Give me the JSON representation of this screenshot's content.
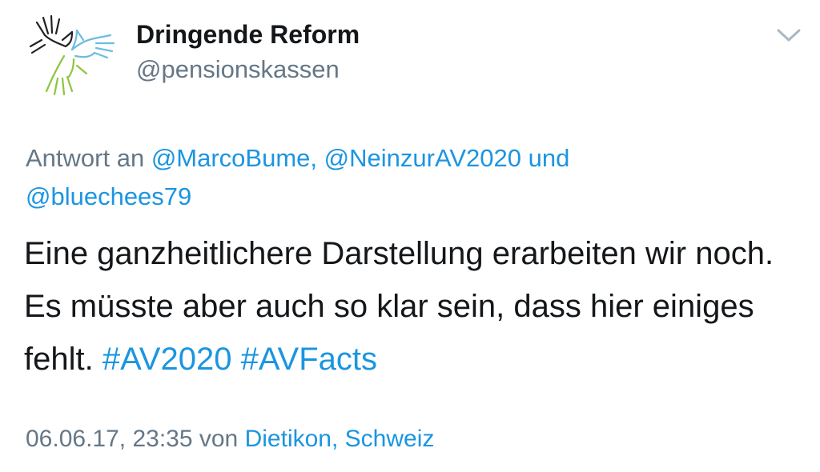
{
  "author": {
    "display_name": "Dringende Reform",
    "handle": "@pensionskassen",
    "avatar_icon": "hands-logo-icon"
  },
  "menu_icon": "chevron-down-icon",
  "reply": {
    "prefix": "Antwort an",
    "mentions": [
      "@MarcoBume,",
      "@NeinzurAV2020"
    ],
    "conjunction": "und",
    "last_mention": "@bluechees79"
  },
  "body": {
    "text": "Eine ganzheitlichere Darstellung erarbeiten wir noch. Es müsste aber auch so klar sein, dass hier einiges fehlt.",
    "hashtags": [
      "#AV2020",
      "#AVFacts"
    ]
  },
  "meta": {
    "timestamp": "06.06.17, 23:35",
    "via_label": "von",
    "location": "Dietikon, Schweiz"
  },
  "colors": {
    "link": "#1b95e0",
    "secondary": "#657786",
    "primary": "#14171a"
  }
}
